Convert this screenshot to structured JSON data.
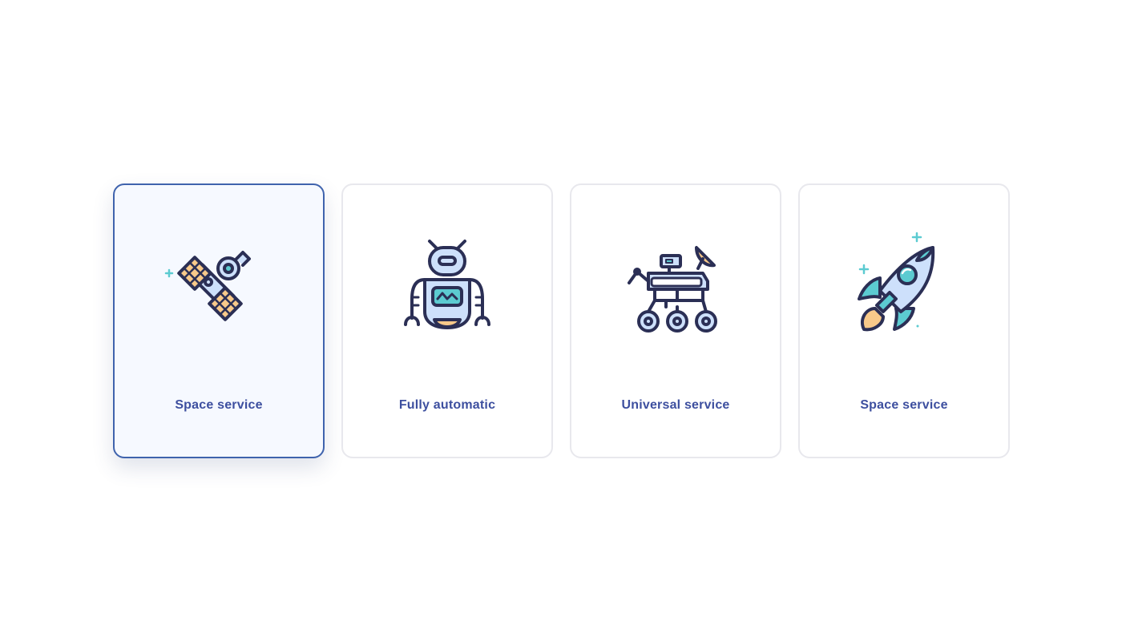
{
  "colors": {
    "accent": "#3f63ad",
    "label": "#3d4f9f",
    "stroke": "#2b2f55",
    "fill_blue": "#cde0fb",
    "fill_teal": "#5ccbd1",
    "fill_orange": "#f8c98a",
    "selected_bg": "#f6f9ff",
    "card_border": "#e8e8ed"
  },
  "cards": [
    {
      "label": "Space service",
      "icon": "satellite-icon",
      "selected": true
    },
    {
      "label": "Fully automatic",
      "icon": "robot-icon",
      "selected": false
    },
    {
      "label": "Universal service",
      "icon": "rover-icon",
      "selected": false
    },
    {
      "label": "Space service",
      "icon": "rocket-icon",
      "selected": false
    }
  ]
}
